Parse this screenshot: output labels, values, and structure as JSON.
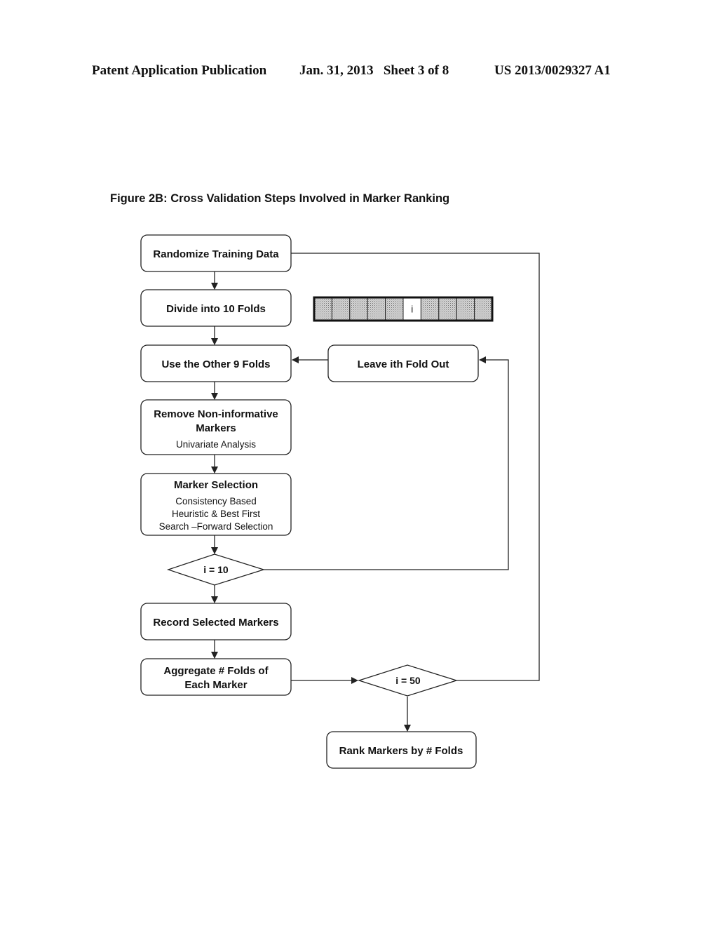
{
  "header": {
    "left": "Patent Application Publication",
    "center": "Jan. 31, 2013   Sheet 3 of 8",
    "right": "US 2013/0029327 A1"
  },
  "figure": {
    "label": "Figure 2B:",
    "title": "Cross Validation Steps Involved in Marker Ranking"
  },
  "nodes": {
    "randomize": {
      "title": "Randomize Training Data"
    },
    "divide": {
      "title": "Divide into 10 Folds"
    },
    "use_other": {
      "title": "Use the Other 9 Folds"
    },
    "leave_out": {
      "title": "Leave ith Fold Out"
    },
    "remove": {
      "title_line1": "Remove Non-informative",
      "title_line2": "Markers",
      "subtitle": "Univariate Analysis"
    },
    "selection": {
      "title": "Marker Selection",
      "sub_line1": "Consistency Based",
      "sub_line2": "Heuristic & Best First",
      "sub_line3": "Search –Forward Selection"
    },
    "decision_10": {
      "label": "i = 10"
    },
    "record": {
      "title": "Record Selected Markers"
    },
    "aggregate": {
      "title_line1": "Aggregate # Folds of",
      "title_line2": "Each Marker"
    },
    "decision_50": {
      "label": "i = 50"
    },
    "rank": {
      "title": "Rank Markers by # Folds"
    }
  },
  "folds": {
    "count": 10,
    "highlighted_index": 6,
    "highlight_label": "i"
  }
}
